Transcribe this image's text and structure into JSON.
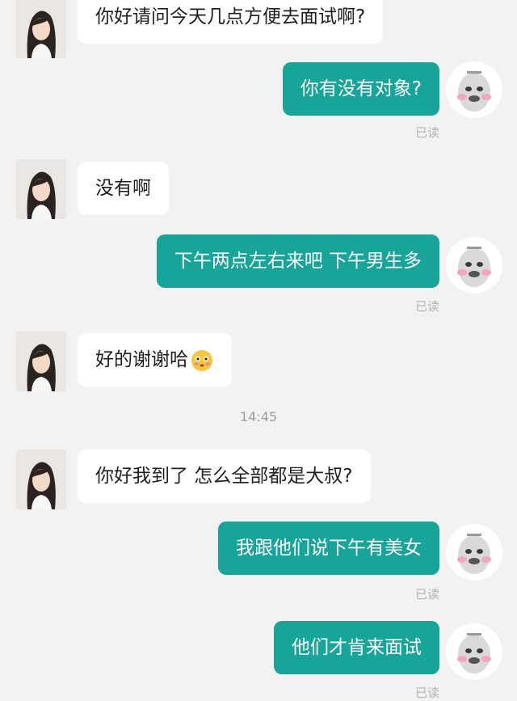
{
  "conversation": {
    "messages": [
      {
        "from": "other",
        "text": "你好请问今天几点方便去面试啊?"
      },
      {
        "from": "me",
        "text": "你有没有对象?",
        "status": "已读"
      },
      {
        "from": "other",
        "text": "没有啊"
      },
      {
        "from": "me",
        "text": "下午两点左右来吧 下午男生多",
        "status": "已读"
      },
      {
        "from": "other",
        "text": "好的谢谢哈",
        "emoji": "flushed-face-emoji"
      },
      {
        "from": "system",
        "text": "14:45"
      },
      {
        "from": "other",
        "text": "你好我到了 怎么全部都是大叔?"
      },
      {
        "from": "me",
        "text": "我跟他们说下午有美女",
        "status": "已读"
      },
      {
        "from": "me",
        "text": "他们才肯来面试",
        "status": "已读"
      }
    ]
  },
  "colors": {
    "background": "#f2f2f2",
    "outgoing_bubble": "#16a598",
    "incoming_bubble": "#ffffff",
    "read_status": "#b3b3b3"
  },
  "icons": {
    "other_avatar": "girl-avatar-icon",
    "my_avatar": "meme-face-avatar-icon"
  }
}
